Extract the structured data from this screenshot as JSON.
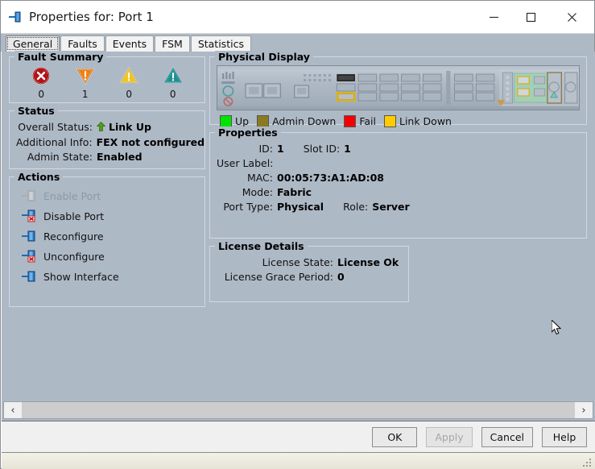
{
  "window": {
    "title": "Properties for: Port 1",
    "icon": "port-interface-icon",
    "controls": {
      "minimize": "—",
      "maximize": "☐",
      "close": "✕"
    }
  },
  "tabs": [
    {
      "label": "General",
      "active": true
    },
    {
      "label": "Faults",
      "active": false
    },
    {
      "label": "Events",
      "active": false
    },
    {
      "label": "FSM",
      "active": false
    },
    {
      "label": "Statistics",
      "active": false
    }
  ],
  "fault_summary": {
    "legend": "Fault Summary",
    "items": [
      {
        "severity": "critical",
        "icon": "critical-circle-x-icon",
        "count": "0",
        "color": "#b31217"
      },
      {
        "severity": "major",
        "icon": "major-inverted-triangle-icon",
        "count": "1",
        "color": "#f07f13"
      },
      {
        "severity": "minor",
        "icon": "minor-triangle-icon",
        "count": "0",
        "color": "#f0c419"
      },
      {
        "severity": "warning",
        "icon": "warning-triangle-icon",
        "count": "0",
        "color": "#1f8f8f"
      }
    ]
  },
  "status": {
    "legend": "Status",
    "overall_status_label": "Overall Status:",
    "overall_status_value": "Link Up",
    "overall_status_icon": "green-up-arrow-icon",
    "additional_info_label": "Additional Info:",
    "additional_info_value": "FEX not configured",
    "admin_state_label": "Admin State:",
    "admin_state_value": "Enabled"
  },
  "actions": {
    "legend": "Actions",
    "items": [
      {
        "label": "Enable Port",
        "icon": "enable-port-icon",
        "disabled": true
      },
      {
        "label": "Disable Port",
        "icon": "disable-port-icon",
        "disabled": false
      },
      {
        "label": "Reconfigure",
        "icon": "reconfigure-icon",
        "disabled": false
      },
      {
        "label": "Unconfigure",
        "icon": "unconfigure-icon",
        "disabled": false
      },
      {
        "label": "Show Interface",
        "icon": "show-interface-icon",
        "disabled": false
      }
    ]
  },
  "physical_display": {
    "legend": "Physical Display",
    "chassis_image": "fabric-interconnect-chassis-graphic",
    "legend_items": [
      {
        "label": "Up",
        "color": "#00e500"
      },
      {
        "label": "Admin Down",
        "color": "#8a7a20"
      },
      {
        "label": "Fail",
        "color": "#f50000"
      },
      {
        "label": "Link Down",
        "color": "#ffcc00"
      }
    ]
  },
  "properties": {
    "legend": "Properties",
    "id_label": "ID:",
    "id_value": "1",
    "slot_id_label": "Slot ID:",
    "slot_id_value": "1",
    "user_label_label": "User Label:",
    "user_label_value": "",
    "mac_label": "MAC:",
    "mac_value": "00:05:73:A1:AD:08",
    "mode_label": "Mode:",
    "mode_value": "Fabric",
    "port_type_label": "Port Type:",
    "port_type_value": "Physical",
    "role_label": "Role:",
    "role_value": "Server"
  },
  "license_details": {
    "legend": "License Details",
    "license_state_label": "License State:",
    "license_state_value": "License Ok",
    "grace_period_label": "License Grace Period:",
    "grace_period_value": "0"
  },
  "scrollbar": {
    "left_arrow": "‹",
    "right_arrow": "›"
  },
  "dialog_buttons": [
    {
      "label": "OK",
      "disabled": false
    },
    {
      "label": "Apply",
      "disabled": true
    },
    {
      "label": "Cancel",
      "disabled": false
    },
    {
      "label": "Help",
      "disabled": false
    }
  ]
}
